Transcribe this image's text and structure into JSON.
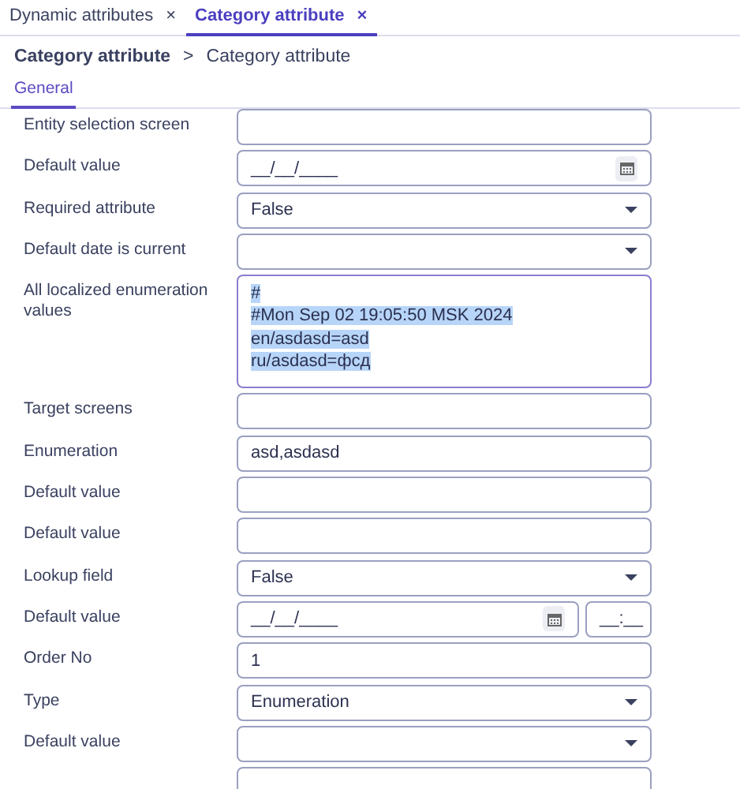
{
  "tabs": [
    {
      "label": "Dynamic attributes",
      "close": "×",
      "selected": false
    },
    {
      "label": "Category attribute",
      "close": "×",
      "selected": true
    }
  ],
  "breadcrumb": {
    "link": "Category attribute",
    "separator": ">",
    "current": "Category attribute"
  },
  "section_tabs": [
    {
      "label": "General",
      "selected": true
    }
  ],
  "fields": [
    {
      "label": "Entity selection screen",
      "kind": "text"
    },
    {
      "label": "Default value",
      "kind": "date",
      "value": "__/__/____"
    },
    {
      "label": "Required attribute",
      "kind": "select",
      "value": "False"
    },
    {
      "label": "Default date is current",
      "kind": "select"
    },
    {
      "label": "All localized enumeration values",
      "kind": "textarea",
      "value": "#\n#Mon Sep 02 19:05:50 MSK 2024\nen/asdasd=asd\nru/asdasd=фсд",
      "text_selected": true
    },
    {
      "label": "Target screens",
      "kind": "text"
    },
    {
      "label": "Enumeration",
      "kind": "text",
      "value": "asd,asdasd"
    },
    {
      "label": "Default value",
      "kind": "text"
    },
    {
      "label": "Default value",
      "kind": "text"
    },
    {
      "label": "Lookup field",
      "kind": "select",
      "value": "False"
    },
    {
      "label": "Default value",
      "kind": "datetime",
      "value": "__/__/____",
      "time": "__:__"
    },
    {
      "label": "Order No",
      "kind": "text",
      "value": "1"
    },
    {
      "label": "Type",
      "kind": "select",
      "value": "Enumeration"
    },
    {
      "label": "Default value",
      "kind": "select"
    },
    {
      "kind": "text"
    }
  ]
}
